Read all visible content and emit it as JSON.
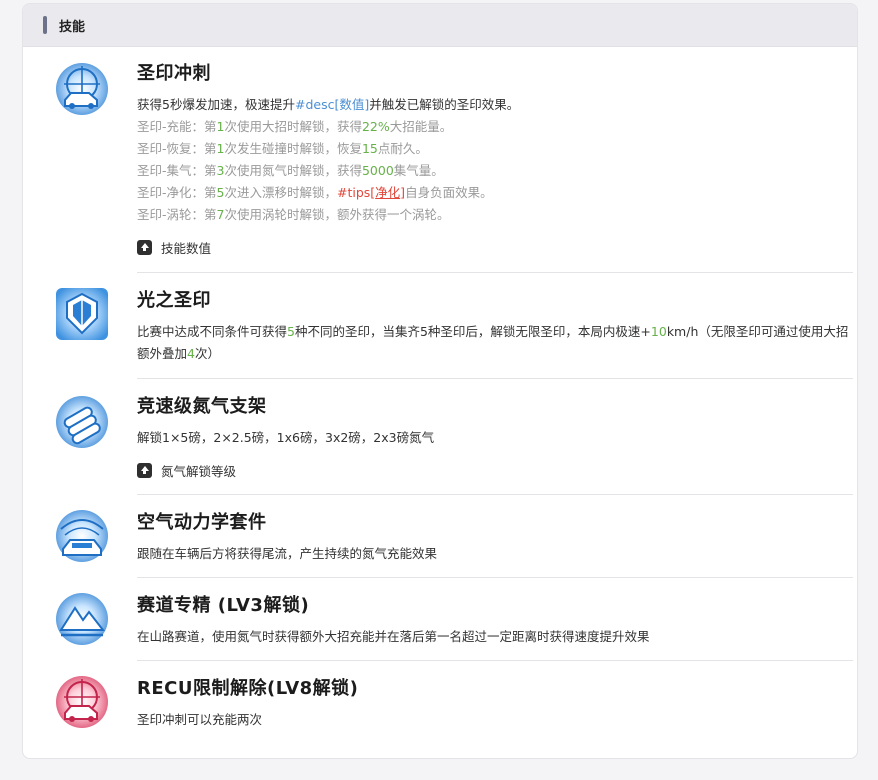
{
  "header": {
    "title": "技能"
  },
  "skills": [
    {
      "name": "圣印冲刺",
      "desc": {
        "p1": "获得5秒爆发加速，极速提升",
        "tag": "#desc[数值]",
        "p2": "并触发已解锁的圣印效果。"
      },
      "sub": [
        {
          "a": "圣印-充能：第",
          "n1": "1",
          "b": "次使用大招时解锁，获得",
          "n2": "22%",
          "c": "大招能量。"
        },
        {
          "a": "圣印-恢复：第",
          "n1": "1",
          "b": "次发生碰撞时解锁，恢复",
          "n2": "15",
          "c": "点耐久。"
        },
        {
          "a": "圣印-集气：第",
          "n1": "3",
          "b": "次使用氮气时解锁，获得",
          "n2": "5000",
          "c": "集气量。"
        },
        {
          "a": "圣印-净化：第",
          "n1": "5",
          "b": "次进入漂移时解锁，",
          "tag1": "#tips[",
          "tag2": "净化",
          "tag3": "]",
          "c": "自身负面效果。"
        },
        {
          "a": "圣印-涡轮：第",
          "n1": "7",
          "b": "次使用涡轮时解锁，额外获得一个涡轮。"
        }
      ],
      "action": "技能数值"
    },
    {
      "name": "光之圣印",
      "desc": {
        "p1": "比赛中达成不同条件可获得",
        "n1": "5",
        "p2": "种不同的圣印，当集齐5种圣印后，解锁无限圣印，本局内极速+",
        "n2": "10",
        "p3": "km/h（无限圣印可通过使用大招额外叠加",
        "n3": "4",
        "p4": "次）"
      }
    },
    {
      "name": "竞速级氮气支架",
      "desc": "解锁1×5磅，2×2.5磅，1x6磅，3x2磅，2x3磅氮气",
      "action": "氮气解锁等级"
    },
    {
      "name": "空气动力学套件",
      "desc": "跟随在车辆后方将获得尾流，产生持续的氮气充能效果"
    },
    {
      "name": "赛道专精 (LV3解锁)",
      "desc": "在山路赛道，使用氮气时获得额外大招充能并在落后第一名超过一定距离时获得速度提升效果"
    },
    {
      "name": "RECU限制解除(LV8解锁)",
      "desc": "圣印冲刺可以充能两次"
    }
  ],
  "colors": {
    "number": "#67b14a",
    "tag": "#4a8fd3",
    "tips": "#e2463a",
    "icon_blue": "#2f8ad8",
    "icon_pink": "#d8365c"
  },
  "icons": [
    "car-crest-icon",
    "shield-emblem-icon",
    "nitro-tanks-icon",
    "aero-car-icon",
    "mountain-icon",
    "car-crest-pink-icon"
  ]
}
